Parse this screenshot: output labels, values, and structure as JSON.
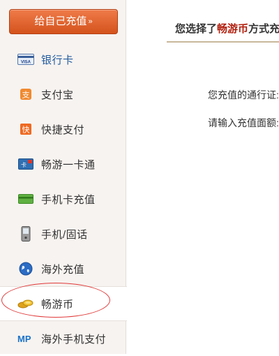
{
  "sidebar": {
    "topup_button": {
      "label": "给自己充值",
      "chevron": "»"
    },
    "items": [
      {
        "label": "银行卡",
        "icon": "bank-card-icon"
      },
      {
        "label": "支付宝",
        "icon": "alipay-icon"
      },
      {
        "label": "快捷支付",
        "icon": "quick-pay-icon"
      },
      {
        "label": "畅游一卡通",
        "icon": "changyou-card-icon"
      },
      {
        "label": "手机卡充值",
        "icon": "phone-card-icon"
      },
      {
        "label": "手机/固话",
        "icon": "mobile-phone-icon"
      },
      {
        "label": "海外充值",
        "icon": "globe-icon"
      },
      {
        "label": "畅游币",
        "icon": "coins-icon"
      },
      {
        "label": "海外手机支付",
        "icon": "mp-logo-icon"
      }
    ],
    "active_item": "畅游币"
  },
  "main": {
    "choice": {
      "prefix": "您选择了",
      "method": "畅游币",
      "suffix": "方式充"
    },
    "fields": {
      "account_label": "您充值的通行证:",
      "amount_label": "请输入充值面额:"
    }
  },
  "colors": {
    "accent": "#d4531c",
    "method_text": "#b2200f",
    "annotation": "#e03a3a",
    "sidebar_bg": "#f7f3f0"
  }
}
